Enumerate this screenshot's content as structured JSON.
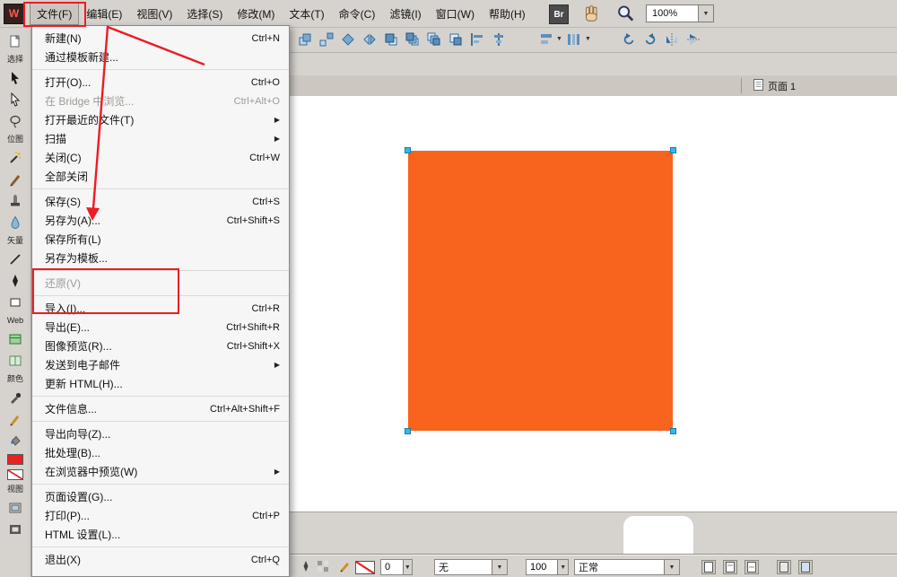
{
  "app": {
    "logo_letter": "W",
    "bridge_button": "Br",
    "zoom_value": "100%"
  },
  "menubar": {
    "items": [
      "文件(F)",
      "编辑(E)",
      "视图(V)",
      "选择(S)",
      "修改(M)",
      "文本(T)",
      "命令(C)",
      "滤镜(I)",
      "窗口(W)",
      "帮助(H)"
    ]
  },
  "file_menu": {
    "items": [
      {
        "label": "新建(N)",
        "shortcut": "Ctrl+N"
      },
      {
        "label": "通过模板新建...",
        "shortcut": ""
      },
      {
        "label": "打开(O)...",
        "shortcut": "Ctrl+O"
      },
      {
        "label": "在 Bridge 中浏览...",
        "shortcut": "Ctrl+Alt+O"
      },
      {
        "label": "打开最近的文件(T)",
        "shortcut": ""
      },
      {
        "label": "扫描",
        "shortcut": ""
      },
      {
        "label": "关闭(C)",
        "shortcut": "Ctrl+W"
      },
      {
        "label": "全部关闭",
        "shortcut": ""
      },
      {
        "label": "保存(S)",
        "shortcut": "Ctrl+S"
      },
      {
        "label": "另存为(A)...",
        "shortcut": "Ctrl+Shift+S"
      },
      {
        "label": "保存所有(L)",
        "shortcut": ""
      },
      {
        "label": "另存为模板...",
        "shortcut": ""
      },
      {
        "label": "还原(V)",
        "shortcut": ""
      },
      {
        "label": "导入(I)...",
        "shortcut": "Ctrl+R"
      },
      {
        "label": "导出(E)...",
        "shortcut": "Ctrl+Shift+R"
      },
      {
        "label": "图像预览(R)...",
        "shortcut": "Ctrl+Shift+X"
      },
      {
        "label": "发送到电子邮件",
        "shortcut": ""
      },
      {
        "label": "更新 HTML(H)...",
        "shortcut": ""
      },
      {
        "label": "文件信息...",
        "shortcut": "Ctrl+Alt+Shift+F"
      },
      {
        "label": "导出向导(Z)...",
        "shortcut": ""
      },
      {
        "label": "批处理(B)...",
        "shortcut": ""
      },
      {
        "label": "在浏览器中预览(W)",
        "shortcut": ""
      },
      {
        "label": "页面设置(G)...",
        "shortcut": ""
      },
      {
        "label": "打印(P)...",
        "shortcut": "Ctrl+P"
      },
      {
        "label": "HTML 设置(L)...",
        "shortcut": ""
      },
      {
        "label": "退出(X)",
        "shortcut": "Ctrl+Q"
      }
    ]
  },
  "icons": {
    "submenu_arrow": "▶",
    "dropdown_arrow": "▼"
  },
  "tools": {
    "sections": [
      "选择",
      "位图",
      "矢量",
      "Web",
      "颜色",
      "视图"
    ]
  },
  "document": {
    "page_tab": "页面 1"
  },
  "properties": {
    "stroke_size": "0",
    "stroke_category": "无",
    "opacity": "100",
    "blend_mode": "正常"
  },
  "colors": {
    "shape_fill": "#f8631e",
    "selection_handle": "#35b9ea",
    "annotation": "#ed1c24",
    "canvas": "#ffffff"
  }
}
